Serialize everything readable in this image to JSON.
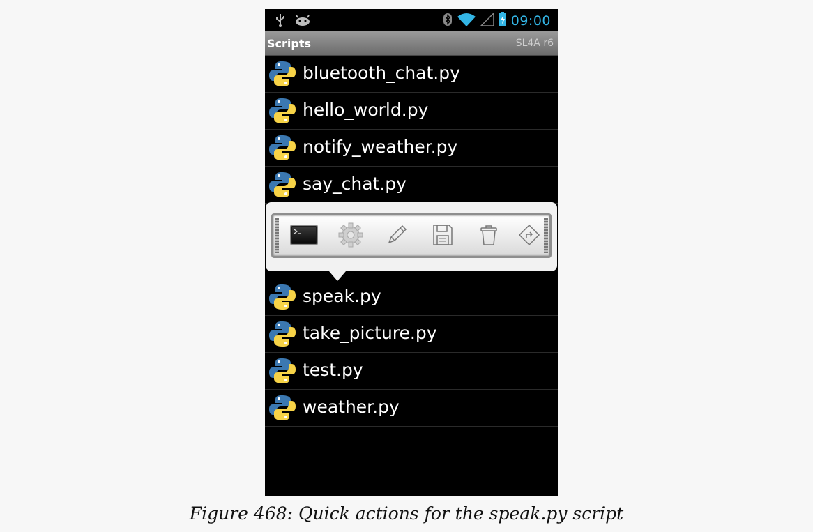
{
  "status_bar": {
    "left_icons": [
      "usb-icon",
      "android-debug-icon"
    ],
    "right_icons": [
      "bluetooth-icon",
      "wifi-icon",
      "signal-icon",
      "battery-charging-icon"
    ],
    "time": "09:00",
    "accent_color": "#33b5e5"
  },
  "title_bar": {
    "title": "Scripts",
    "version": "SL4A r6"
  },
  "scripts": [
    {
      "name": "bluetooth_chat.py"
    },
    {
      "name": "hello_world.py"
    },
    {
      "name": "notify_weather.py"
    },
    {
      "name": "say_chat.py"
    },
    {
      "name": "speak.py"
    },
    {
      "name": "take_picture.py"
    },
    {
      "name": "test.py"
    },
    {
      "name": "weather.py"
    }
  ],
  "quick_actions": {
    "target_script": "speak.py",
    "buttons": [
      "run-in-terminal-icon",
      "run-in-background-icon",
      "edit-icon",
      "save-icon",
      "delete-icon",
      "open-external-icon"
    ]
  },
  "caption": "Figure 468: Quick actions for the speak.py script"
}
